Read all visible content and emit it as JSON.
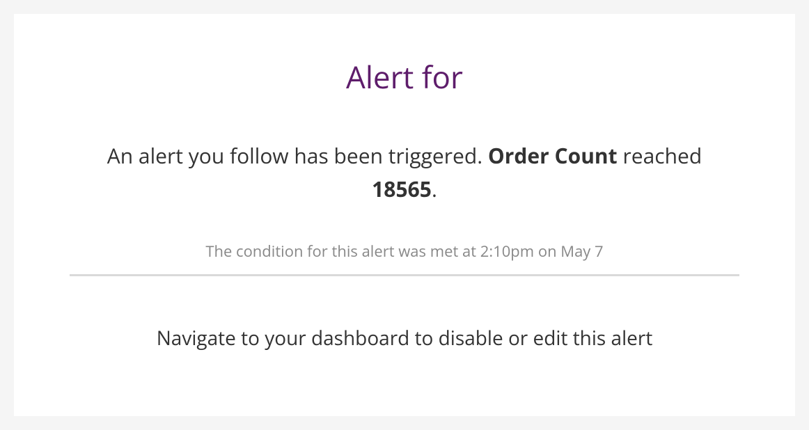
{
  "title": "Alert for",
  "message": {
    "prefix": "An alert you follow has been triggered. ",
    "metric": "Order Count",
    "middle": " reached ",
    "value": "18565",
    "suffix": "."
  },
  "condition": "The condition for this alert was met at 2:10pm on May 7",
  "footer": "Navigate to your dashboard to disable or edit this alert"
}
